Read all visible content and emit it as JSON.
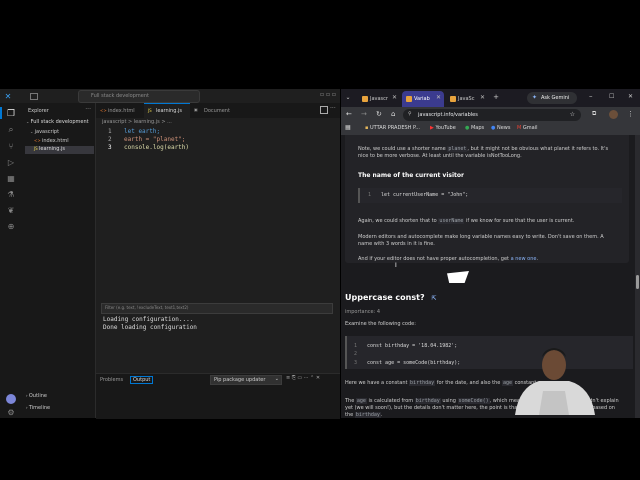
{
  "vscode": {
    "title": "Full stack development",
    "explorer_title": "Explorer",
    "root_folder": "Full stack development",
    "folder": "javascript",
    "files": [
      "index.html",
      "learning.js"
    ],
    "tabs": [
      "index.html",
      "learning.js",
      "Document"
    ],
    "breadcrumb": "javascript > learning.js > ...",
    "code_lines": [
      {
        "num": "1",
        "text": "let earth;"
      },
      {
        "num": "2",
        "text": "earth = \"planet\";"
      },
      {
        "num": "3",
        "text": "console.log(earth)"
      }
    ],
    "panel_tabs": [
      "Problems",
      "Output"
    ],
    "panel_dropdown": "Pip package updater",
    "filter_placeholder": "Filter (e.g. text, !excludeText, text1,text2)",
    "output_lines": [
      "Loading configuration....",
      "Done loading configuration"
    ],
    "outline": "Outline",
    "timeline": "Timeline"
  },
  "chrome": {
    "tabs": [
      "Javascr",
      "Variab",
      "JavaSc"
    ],
    "ask_gemini": "Ask Gemini",
    "url": "javascript.info/variables",
    "bookmarks": [
      "UTTAR PRADESH P...",
      "YouTube",
      "Maps",
      "News",
      "Gmail"
    ],
    "page": {
      "note_a": "Note, we could use a shorter name",
      "note_code": "planet",
      "note_b": ", but it might not be obvious what planet it refers to. It's",
      "note_line2": "nice to be more verbose. At least until the variable isNotTooLong.",
      "visitor_heading": "The name of the current visitor",
      "visitor_line_num": "1",
      "visitor_code": "let currentUserName = \"John\";",
      "again_a": "Again, we could shorten that to",
      "again_code": "userName",
      "again_b": "if we know for sure that the user is current.",
      "modern_line1": "Modern editors and autocomplete make long variable names easy to write. Don't save on them. A",
      "modern_line2": "name with 3 words in it is fine.",
      "autocomplete_a": "And if your editor does not have proper autocompletion, get",
      "autocomplete_link": "a new one",
      "autocomplete_b": ".",
      "section_heading": "Uppercase const?",
      "importance": "importance: 4",
      "examine": "Examine the following code:",
      "code_nums": [
        "1",
        "2",
        "3"
      ],
      "code_line1": "const birthday = '18.04.1982';",
      "code_line3": "const age = someCode(birthday);",
      "constant_a": "Here we have a constant",
      "constant_code": "birthday",
      "constant_b": "for the date, and also the",
      "constant_code2": "age",
      "constant_c": "constant.",
      "age_a": "The",
      "age_code": "age",
      "age_b": "is calculated from",
      "age_code2": "birthday",
      "age_c": "using",
      "age_code3": "someCode()",
      "age_d": ", which means a function call that we didn't explain",
      "age_line2": "yet (we will soon!), but the details don't matter here, the point is that",
      "age_code4": "age",
      "age_line2b": "is calculated somehow based on",
      "age_line3": "the",
      "age_code5": "birthday",
      "age_line3b": "."
    }
  },
  "colors": {
    "accent": "#0078d4",
    "code_keyword": "#569cd6",
    "code_string": "#ce9178",
    "link": "#8ab4f8"
  }
}
